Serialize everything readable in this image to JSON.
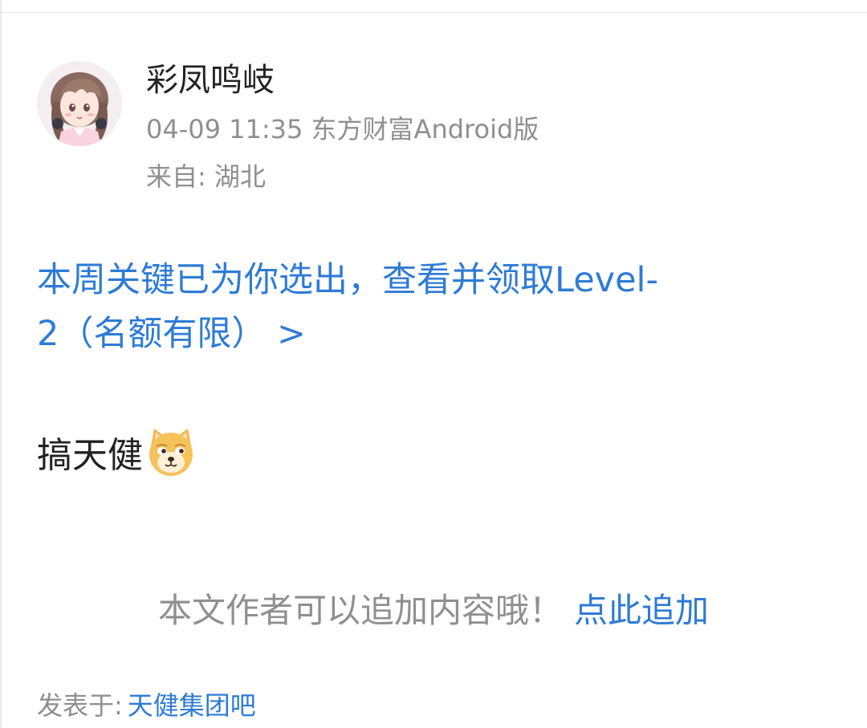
{
  "post": {
    "author": {
      "name": "彩凤鸣岐",
      "avatar": "avatar-anime-girl-icon"
    },
    "meta": {
      "datetime": "04-09 11:35",
      "client": "东方财富Android版",
      "location": "来自: 湖北"
    },
    "promo": {
      "line1": "本周关键已为你选出，查看并领取Level-",
      "line2": "2（名额有限） >"
    },
    "body": {
      "text": "搞天健",
      "emoji": "doge-emoji-icon"
    },
    "append": {
      "hint": "本文作者可以追加内容哦！",
      "link_label": "点此追加"
    },
    "posted_in": {
      "label": "发表于:",
      "board": "天健集团吧"
    }
  },
  "colors": {
    "link": "#2e7bd6",
    "muted": "#8f8f8f",
    "text": "#222222"
  }
}
